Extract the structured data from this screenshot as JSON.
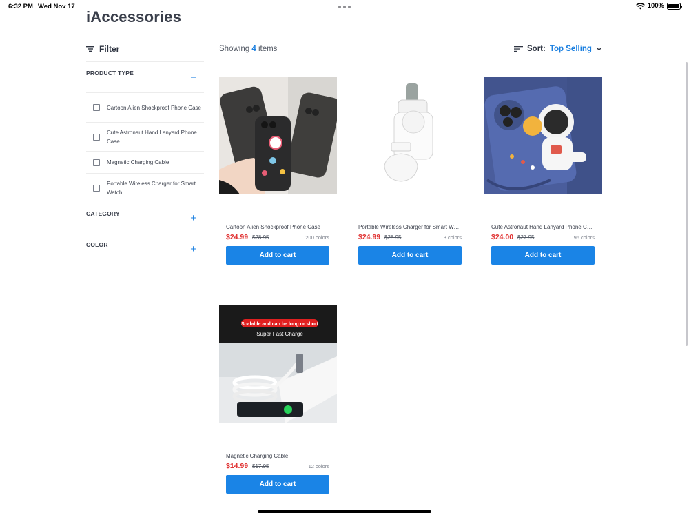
{
  "status_bar": {
    "time": "6:32 PM",
    "date": "Wed Nov 17",
    "battery": "100%",
    "battery_level": 1.0
  },
  "brand": {
    "title": "iAccessories"
  },
  "sidebar": {
    "filter_label": "Filter",
    "product_type": {
      "title": "PRODUCT TYPE",
      "toggle": "−",
      "options": [
        "Cartoon Alien Shockproof Phone Case",
        "Cute Astronaut Hand Lanyard Phone Case",
        "Magnetic Charging Cable",
        "Portable Wireless Charger for Smart Watch"
      ]
    },
    "category": {
      "title": "CATEGORY",
      "toggle": "+"
    },
    "color": {
      "title": "COLOR",
      "toggle": "+"
    }
  },
  "results": {
    "prefix": "Showing",
    "count": "4",
    "suffix": "items"
  },
  "sort": {
    "label": "Sort:",
    "value": "Top Selling"
  },
  "products": [
    {
      "name": "Cartoon Alien Shockproof Phone Case",
      "price": "$24.99",
      "old_price": "$28.95",
      "colors": "200 colors",
      "button": "Add to cart"
    },
    {
      "name": "Portable Wireless Charger for Smart Watch",
      "price": "$24.99",
      "old_price": "$28.95",
      "colors": "3 colors",
      "button": "Add to cart"
    },
    {
      "name": "Cute Astronaut Hand Lanyard Phone Case",
      "price": "$24.00",
      "old_price": "$27.95",
      "colors": "96 colors",
      "button": "Add to cart"
    },
    {
      "name": "Magnetic Charging Cable",
      "price": "$14.99",
      "old_price": "$17.95",
      "colors": "12 colors",
      "button": "Add to cart",
      "image_banner": "Scalable and can be long or short",
      "image_caption": "Super Fast Charge"
    }
  ],
  "colors": {
    "accent": "#1a84e6",
    "price_red": "#e03131",
    "text_dark": "#3a3f4b"
  }
}
